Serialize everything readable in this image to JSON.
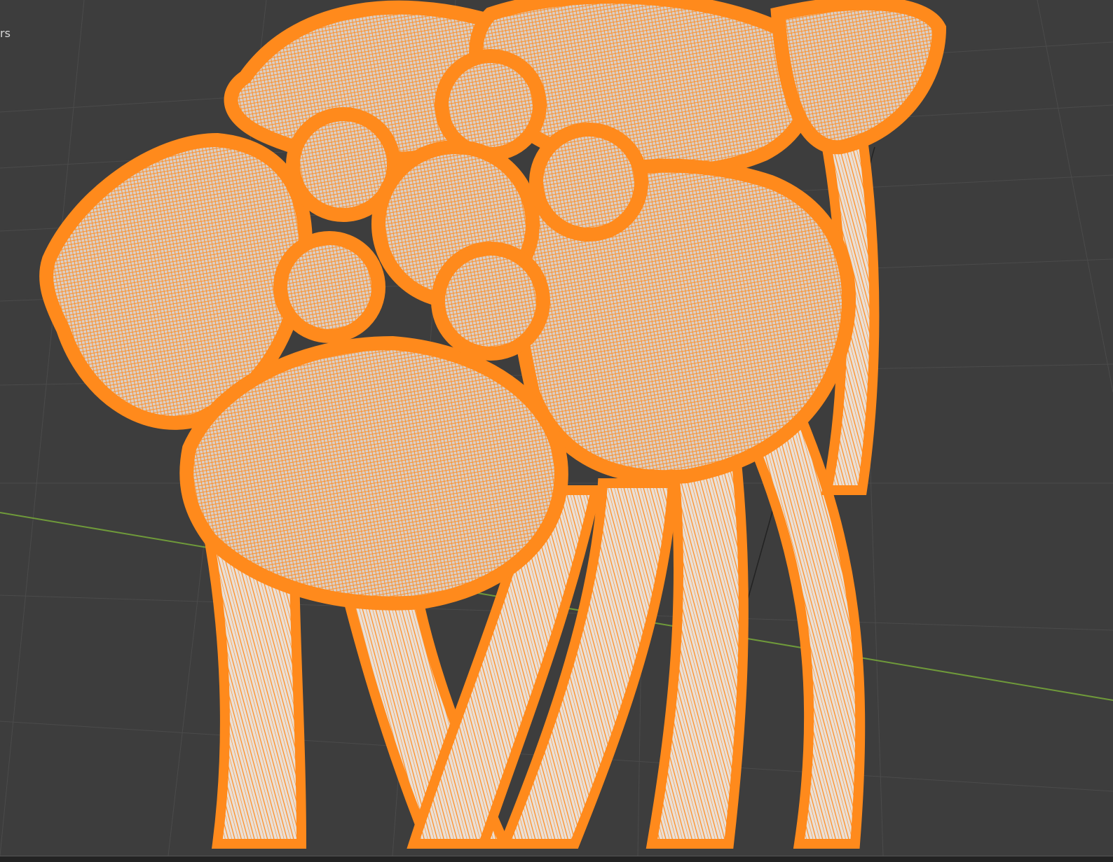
{
  "viewport": {
    "overlay_label": "rs",
    "background_color": "#3d3d3d",
    "grid_color": "#4a4a4a",
    "x_axis_color": "#6f9a3a",
    "y_axis_color": "#b23a48",
    "selection_color": "#ff8a1c",
    "object_icon": "3d-mesh-wireframe-flower",
    "shading": "wireframe-over-solid"
  }
}
